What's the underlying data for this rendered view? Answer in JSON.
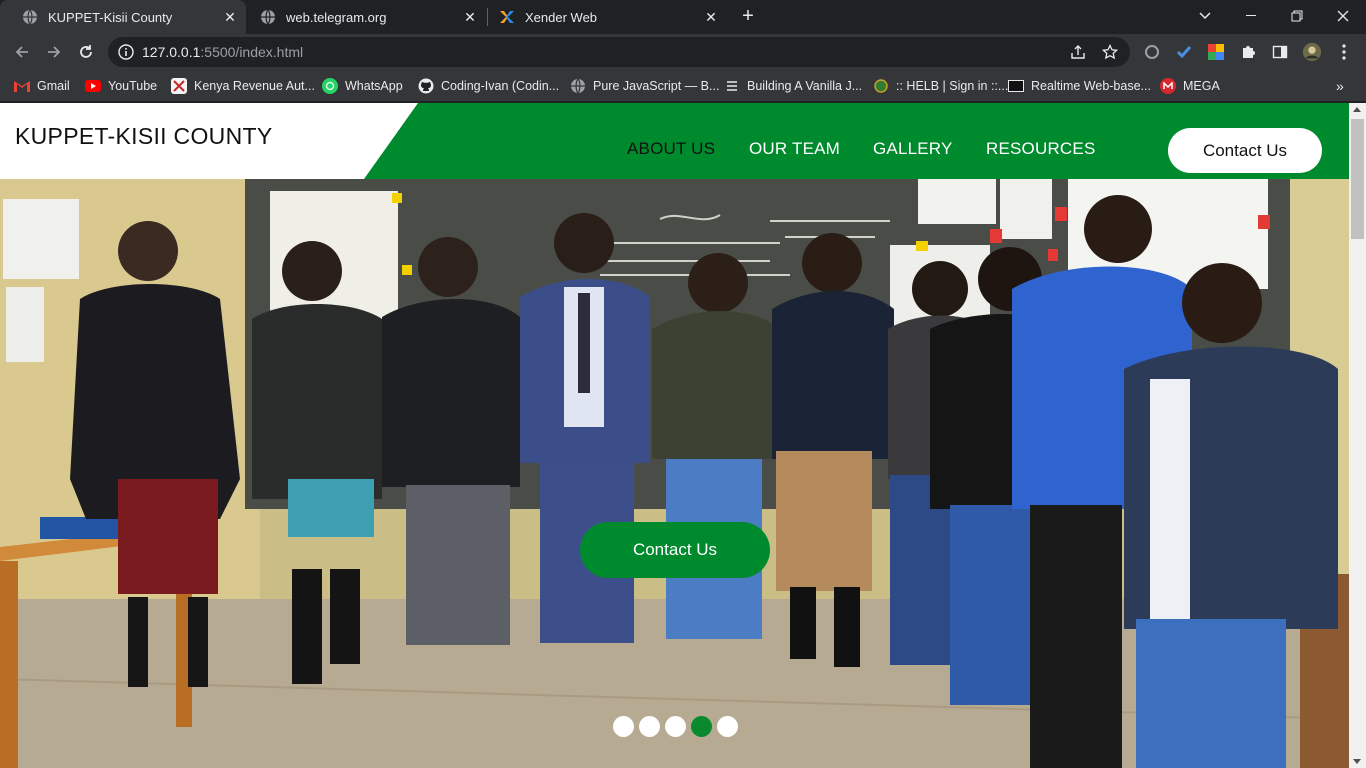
{
  "browser": {
    "tabs": [
      {
        "title": "KUPPET-Kisii County",
        "favicon": "globe-icon",
        "active": true
      },
      {
        "title": "web.telegram.org",
        "favicon": "globe-icon",
        "active": false
      },
      {
        "title": "Xender Web",
        "favicon": "xender-icon",
        "active": false
      }
    ],
    "url_host": "127.0.0.1",
    "url_path": ":5500/index.html",
    "bookmarks": [
      {
        "label": "Gmail",
        "icon": "gmail-icon"
      },
      {
        "label": "YouTube",
        "icon": "youtube-icon"
      },
      {
        "label": "Kenya Revenue Aut...",
        "icon": "kra-icon"
      },
      {
        "label": "WhatsApp",
        "icon": "whatsapp-icon"
      },
      {
        "label": "Coding-Ivan (Codin...",
        "icon": "github-icon"
      },
      {
        "label": "Pure JavaScript — B...",
        "icon": "globe-icon"
      },
      {
        "label": "Building A Vanilla J...",
        "icon": "site-icon"
      },
      {
        "label": ":: HELB | Sign in ::...",
        "icon": "helb-icon"
      },
      {
        "label": "Realtime Web-base...",
        "icon": "page-icon"
      },
      {
        "label": "MEGA",
        "icon": "mega-icon"
      }
    ]
  },
  "site": {
    "brand": "KUPPET-KISII COUNTY",
    "nav": [
      {
        "label": "ABOUT US",
        "current": true
      },
      {
        "label": "OUR TEAM",
        "current": false
      },
      {
        "label": "GALLERY",
        "current": false
      },
      {
        "label": "RESOURCES",
        "current": false
      }
    ],
    "header_cta": "Contact Us",
    "hero_cta": "Contact Us",
    "carousel": {
      "slides": 5,
      "active_index": 3
    },
    "colors": {
      "brand_green": "#008a2e",
      "white": "#ffffff"
    }
  }
}
